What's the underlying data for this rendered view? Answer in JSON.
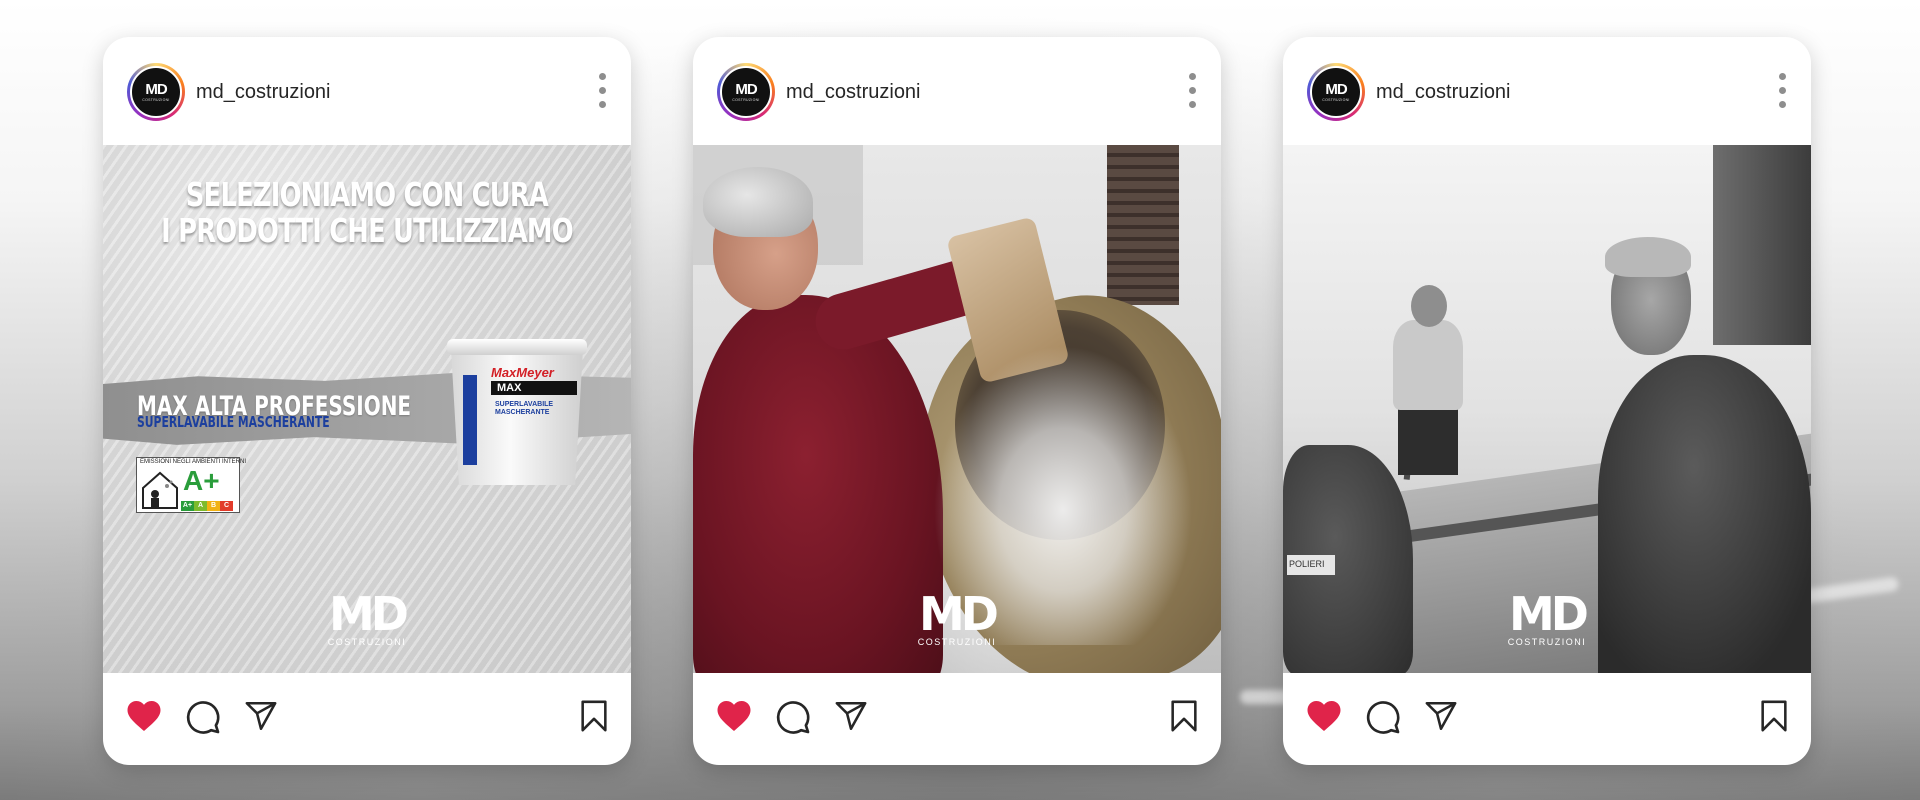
{
  "posts": [
    {
      "username": "md_costruzioni",
      "avatar": {
        "logo": "MD",
        "sub": "COSTRUZIONI"
      },
      "photo": {
        "headline": [
          "SELEZIONIAMO CON CURA",
          "I PRODOTTI CHE UTILIZZIAMO"
        ],
        "product_name": "MAX ALTA PROFESSIONE",
        "product_tag": "SUPERLAVABILE MASCHERANTE",
        "emission_title": "EMISSIONI NEGLI AMBIENTI INTERNI",
        "emission_grade": "A+",
        "emission_scale": [
          "A+",
          "A",
          "B",
          "C"
        ],
        "bucket_brand": "MaxMeyer",
        "bucket_line": "MAX",
        "bucket_desc": [
          "SUPERLAVABILE",
          "MASCHERANTE"
        ],
        "logo_mark": "MD",
        "logo_word": "COSTRUZIONI"
      }
    },
    {
      "username": "md_costruzioni",
      "avatar": {
        "logo": "MD",
        "sub": "COSTRUZIONI"
      },
      "photo": {
        "logo_mark": "MD",
        "logo_word": "COSTRUZIONI"
      }
    },
    {
      "username": "md_costruzioni",
      "avatar": {
        "logo": "MD",
        "sub": "COSTRUZIONI"
      },
      "photo": {
        "logo_mark": "MD",
        "logo_word": "COSTRUZIONI",
        "mixer_label": "POLIERI"
      }
    }
  ],
  "icons": {
    "more": "more-vertical-icon",
    "like": "heart-icon",
    "comment": "comment-icon",
    "share": "send-icon",
    "save": "bookmark-icon"
  },
  "colors": {
    "like": "#e0244a",
    "username": "#262626",
    "scale": [
      "#2a9d3b",
      "#7dbb2d",
      "#f1b215",
      "#e23b2a"
    ]
  }
}
